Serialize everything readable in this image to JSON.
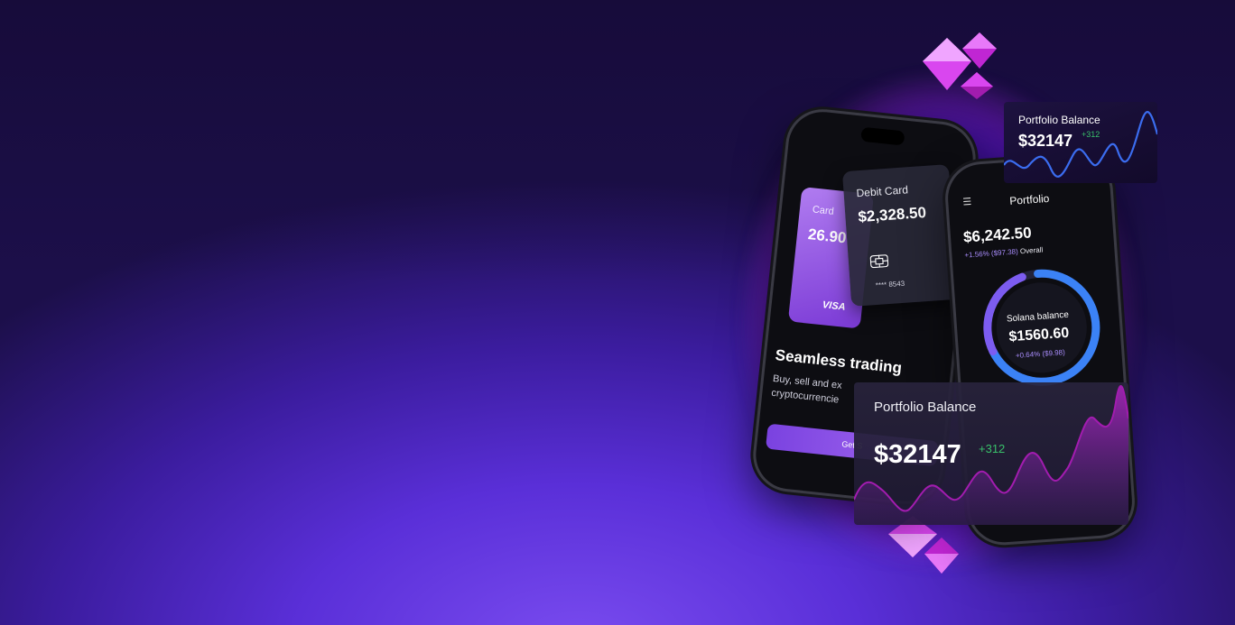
{
  "left_phone": {
    "card_label": "Card",
    "card_amount": "26.90",
    "card_brand": "VISA",
    "headline": "Seamless trading",
    "subtext": "Buy, sell and ex cryptocurrencie",
    "button_label": "Get S"
  },
  "debit_card": {
    "label": "Debit Card",
    "amount": "$2,328.50",
    "number": "**** 8543"
  },
  "portfolio_phone": {
    "menu_icon": "☰",
    "title": "Portfolio",
    "total": "$6,242.50",
    "change": "+1.56% ($97.38)",
    "change_suffix": "Overall",
    "ring_label": "Solana balance",
    "ring_amount": "$1560.60",
    "ring_change": "+0.64% ($9.98)"
  },
  "portfolio_balance_small": {
    "title": "Portfolio Balance",
    "amount": "$32147",
    "delta": "+312"
  },
  "portfolio_balance_large": {
    "title": "Portfolio Balance",
    "amount": "$32147",
    "delta": "+312"
  },
  "colors": {
    "accent_purple": "#a56af0",
    "positive_green": "#39c06a",
    "chart_blue": "#3b6df0",
    "chart_magenta": "#c026d3"
  }
}
